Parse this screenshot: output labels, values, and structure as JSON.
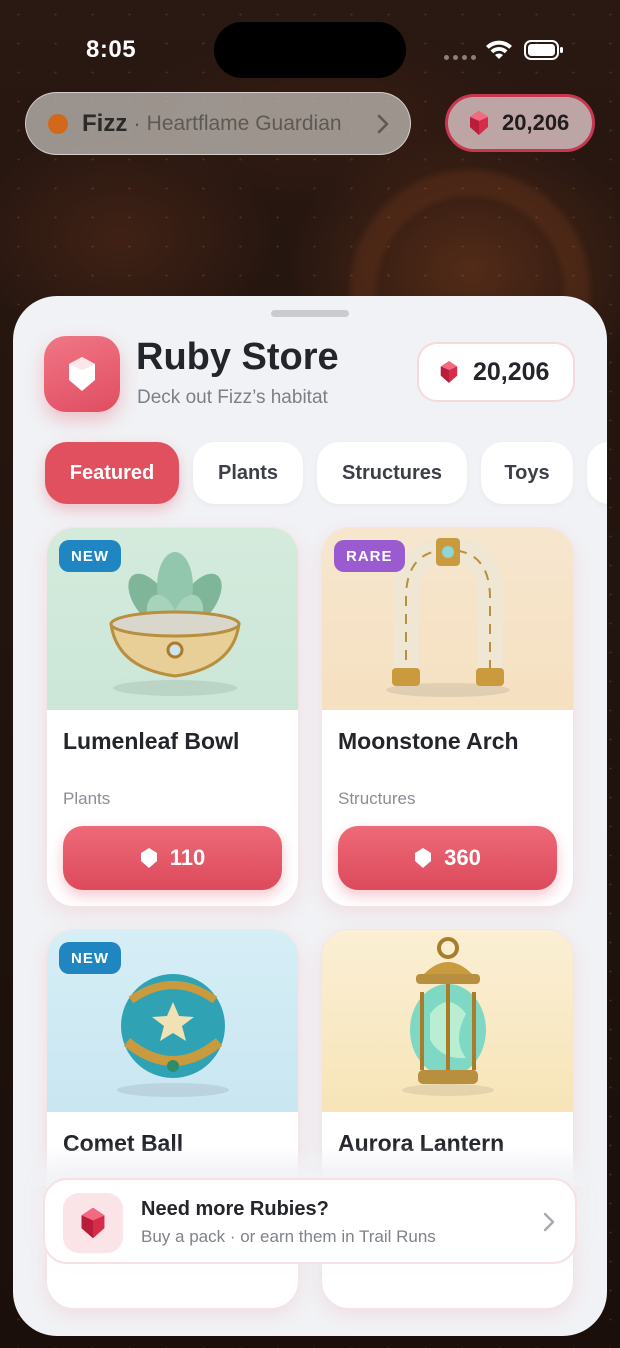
{
  "status_bar": {
    "time": "8:05"
  },
  "pet": {
    "name": "Fizz",
    "separator": "·",
    "title": "Heartflame Guardian"
  },
  "top_balance": "20,206",
  "store": {
    "title": "Ruby Store",
    "subtitle": "Deck out Fizz’s habitat",
    "balance": "20,206"
  },
  "tabs": [
    {
      "label": "Featured",
      "active": true
    },
    {
      "label": "Plants"
    },
    {
      "label": "Structures"
    },
    {
      "label": "Toys"
    },
    {
      "label": ""
    }
  ],
  "items": [
    {
      "badge": "NEW",
      "name": "Lumenleaf Bowl",
      "category": "Plants",
      "price": "110"
    },
    {
      "badge": "RARE",
      "name": "Moonstone Arch",
      "category": "Structures",
      "price": "360"
    },
    {
      "badge": "NEW",
      "name": "Comet Ball"
    },
    {
      "name": "Aurora Lantern"
    }
  ],
  "banner": {
    "title": "Need more Rubies?",
    "subtitle": "Buy a pack · or earn them in Trail Runs"
  },
  "colors": {
    "accent": "#e0505f",
    "badge_new": "#1f86c1",
    "badge_rare": "#9a5bd0",
    "pet_dot": "#d2691a"
  },
  "icons": [
    "ruby-icon",
    "gem-outline-icon",
    "chevron-right-icon",
    "wifi-icon",
    "battery-icon"
  ]
}
